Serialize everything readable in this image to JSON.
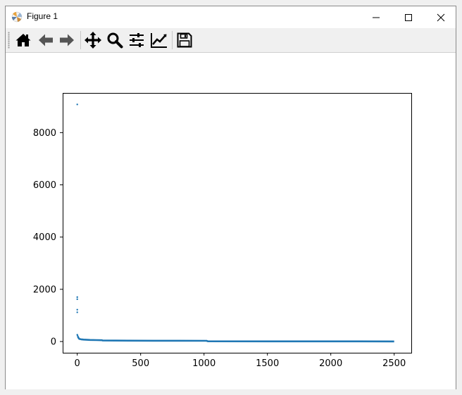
{
  "window": {
    "title": "Figure 1"
  },
  "toolbar": {
    "buttons": [
      {
        "name": "home-icon"
      },
      {
        "name": "back-arrow-icon"
      },
      {
        "name": "forward-arrow-icon"
      },
      {
        "name": "pan-move-icon"
      },
      {
        "name": "zoom-magnifier-icon"
      },
      {
        "name": "configure-subplots-icon"
      },
      {
        "name": "edit-axis-curve-icon"
      },
      {
        "name": "save-floppy-icon"
      }
    ]
  },
  "chart_data": {
    "type": "scatter",
    "title": "",
    "xlabel": "",
    "ylabel": "",
    "xlim": [
      -115,
      2635
    ],
    "ylim": [
      -430,
      9520
    ],
    "xticks": [
      "0",
      "500",
      "1000",
      "1500",
      "2000",
      "2500"
    ],
    "yticks": [
      "0",
      "2000",
      "4000",
      "6000",
      "8000"
    ],
    "xtick_values": [
      0,
      500,
      1000,
      1500,
      2000,
      2500
    ],
    "ytick_values": [
      0,
      2000,
      4000,
      6000,
      8000
    ],
    "marker_color": "#1f77b4",
    "grid": false,
    "outliers": [
      {
        "x": 0,
        "y": 9080
      },
      {
        "x": 0,
        "y": 1700
      },
      {
        "x": 0,
        "y": 1620
      },
      {
        "x": 0,
        "y": 1220
      },
      {
        "x": 0,
        "y": 1120
      },
      {
        "x": 0,
        "y": 260
      },
      {
        "x": 2,
        "y": 230
      }
    ],
    "curve": [
      {
        "x": 4,
        "y": 200
      },
      {
        "x": 6,
        "y": 180
      },
      {
        "x": 8,
        "y": 160
      },
      {
        "x": 10,
        "y": 140
      },
      {
        "x": 12,
        "y": 120
      },
      {
        "x": 15,
        "y": 105
      },
      {
        "x": 20,
        "y": 95
      },
      {
        "x": 30,
        "y": 85
      },
      {
        "x": 50,
        "y": 75
      },
      {
        "x": 100,
        "y": 60
      },
      {
        "x": 150,
        "y": 55
      },
      {
        "x": 195,
        "y": 50
      },
      {
        "x": 200,
        "y": 38
      },
      {
        "x": 400,
        "y": 34
      },
      {
        "x": 600,
        "y": 32
      },
      {
        "x": 800,
        "y": 30
      },
      {
        "x": 1020,
        "y": 28
      },
      {
        "x": 1030,
        "y": 10
      },
      {
        "x": 1500,
        "y": 8
      },
      {
        "x": 2000,
        "y": 6
      },
      {
        "x": 2500,
        "y": 5
      }
    ]
  }
}
